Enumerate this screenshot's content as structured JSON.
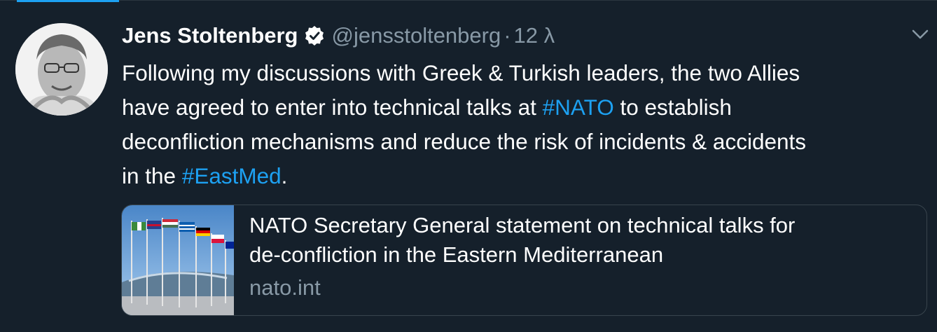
{
  "tweet": {
    "author": {
      "display_name": "Jens Stoltenberg",
      "handle": "@jensstoltenberg",
      "verified": true,
      "avatar_icon": "avatar-photo"
    },
    "separator": "·",
    "time": "12 λ",
    "text_lines": [
      {
        "parts": [
          "Following my discussions with Greek & Turkish leaders, the two Allies"
        ]
      },
      {
        "before": "have agreed to enter into technical talks at ",
        "hashtag": "#NATO",
        "after": " to establish"
      },
      {
        "parts": [
          "deconfliction mechanisms and reduce the risk of incidents & accidents"
        ]
      },
      {
        "before": "in the ",
        "hashtag": "#EastMed",
        "after": "."
      }
    ],
    "card": {
      "title_lines": [
        "NATO Secretary General statement on technical talks for",
        "de-confliction in the Eastern Mediterranean"
      ],
      "domain": "nato.int",
      "thumbnail_icon": "nato-flags-photo"
    }
  },
  "colors": {
    "background": "#15202b",
    "accent": "#1da1f2",
    "secondary_text": "#8899a6",
    "border": "#38444d"
  },
  "icons": {
    "verified": "verified-badge-icon",
    "more": "chevron-down-icon"
  }
}
